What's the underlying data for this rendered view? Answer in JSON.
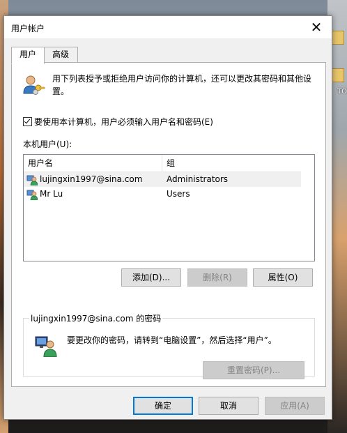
{
  "window": {
    "title": "用户帐户"
  },
  "tabs": [
    {
      "label": "用户",
      "active": true
    },
    {
      "label": "高级",
      "active": false
    }
  ],
  "info": {
    "text": "用下列表授予或拒绝用户访问你的计算机，还可以更改其密码和其他设置。"
  },
  "require_login": {
    "label": "要使用本计算机，用户必须输入用户名和密码(E)",
    "checked": true
  },
  "users": {
    "label": "本机用户(U):",
    "columns": [
      "用户名",
      "组"
    ],
    "rows": [
      {
        "name": "lujingxin1997@sina.com",
        "group": "Administrators",
        "selected": true
      },
      {
        "name": "Mr Lu",
        "group": "Users",
        "selected": false
      }
    ]
  },
  "user_buttons": {
    "add": "添加(D)...",
    "remove": "删除(R)",
    "properties": "属性(O)"
  },
  "password": {
    "title": "lujingxin1997@sina.com 的密码",
    "text": "要更改你的密码，请转到“电脑设置”，然后选择“用户”。",
    "reset_label": "重置密码(P)..."
  },
  "footer": {
    "ok": "确定",
    "cancel": "取消",
    "apply": "应用(A)"
  },
  "desktop": {
    "icon_label": "TO"
  },
  "colors": {
    "accent": "#0078d7",
    "dialog_bg": "#f0f0f0",
    "panel_bg": "#ffffff"
  }
}
